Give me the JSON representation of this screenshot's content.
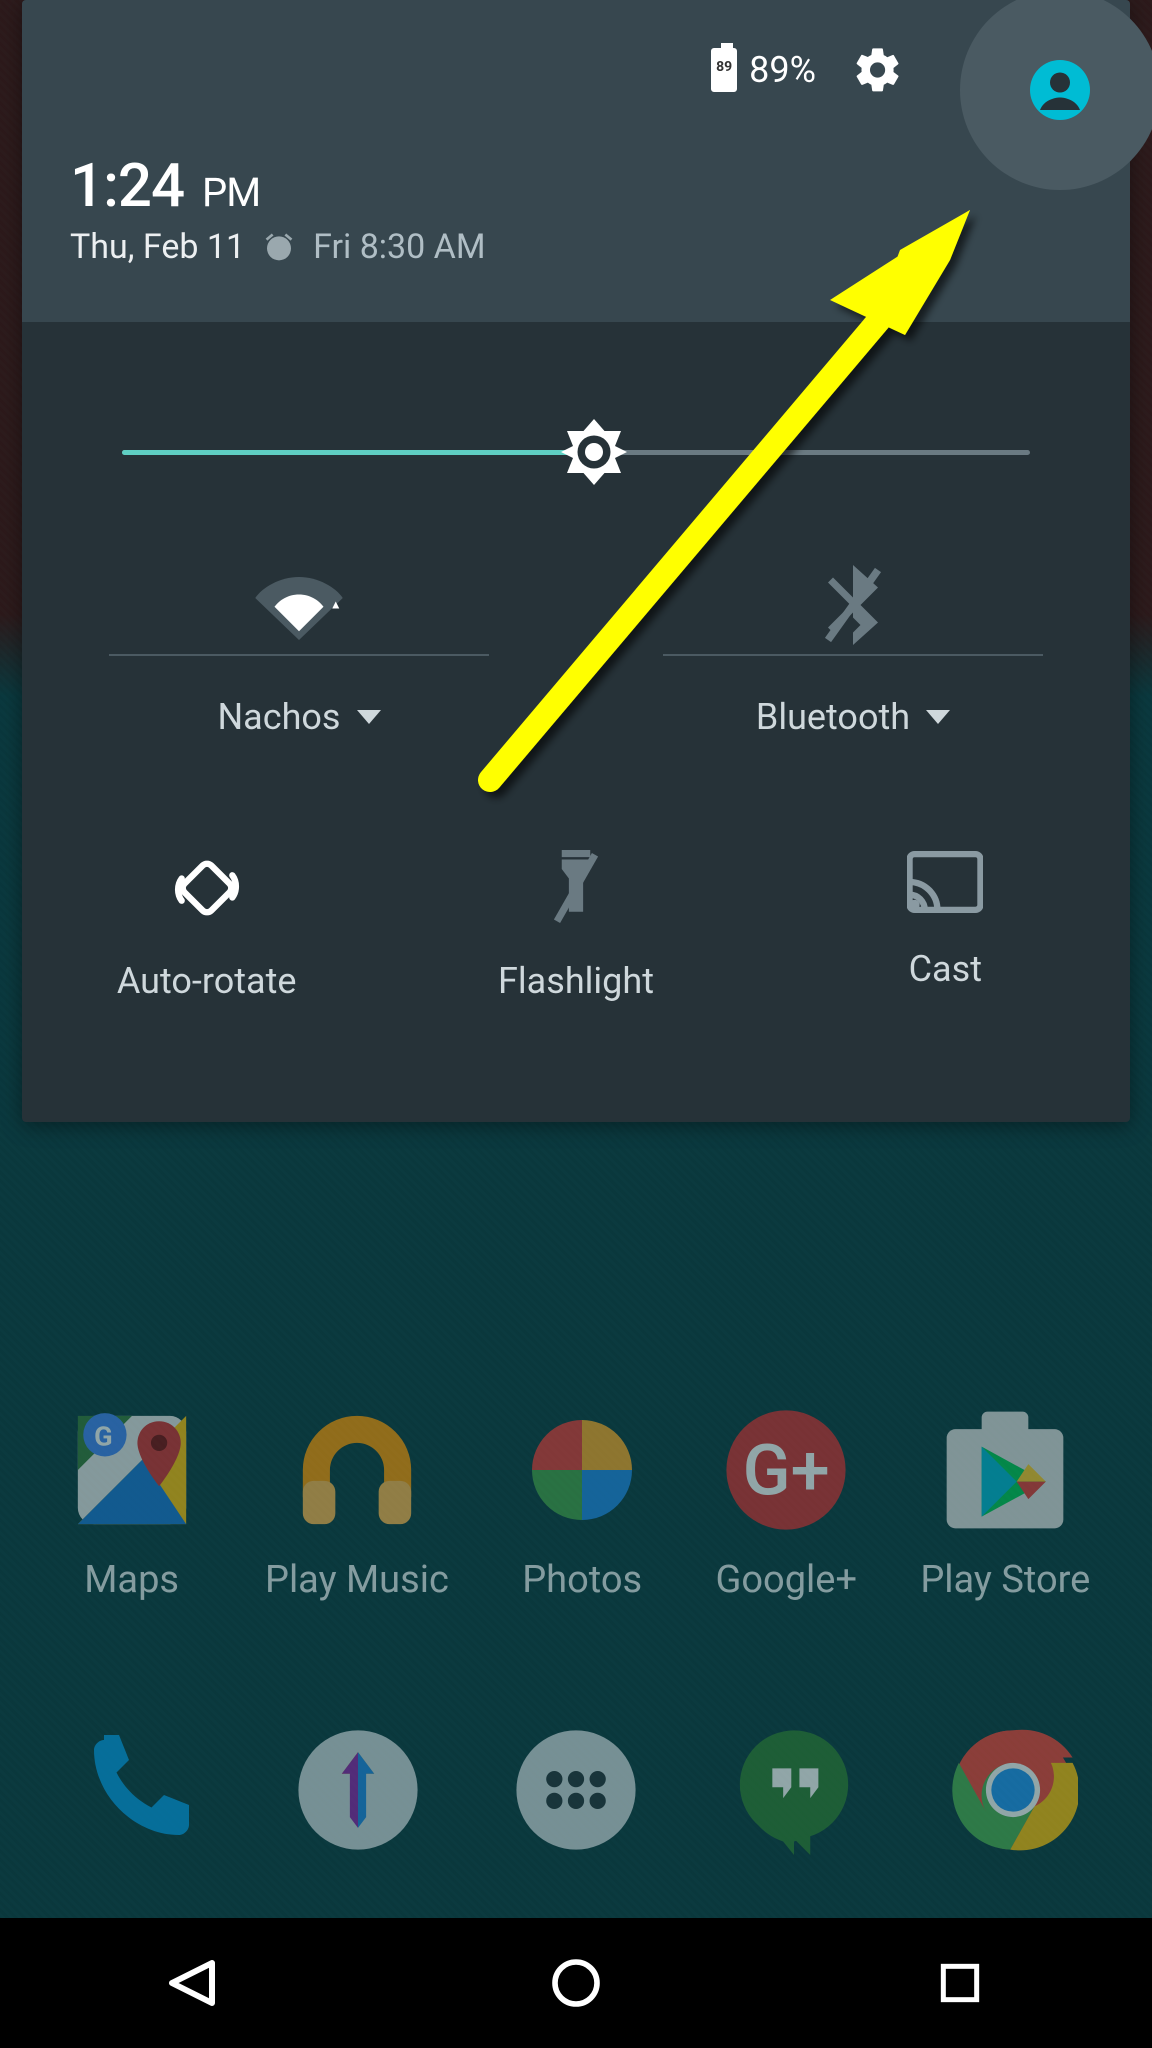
{
  "status": {
    "battery_pct": "89%",
    "battery_num": "89"
  },
  "clock": {
    "time": "1:24",
    "ampm": "PM",
    "date": "Thu, Feb 11",
    "alarm": "Fri 8:30 AM"
  },
  "brightness": {
    "value_pct": 52
  },
  "qs": {
    "wifi": {
      "label": "Nachos"
    },
    "bluetooth": {
      "label": "Bluetooth"
    },
    "rotate": {
      "label": "Auto-rotate"
    },
    "flashlight": {
      "label": "Flashlight"
    },
    "cast": {
      "label": "Cast"
    }
  },
  "apps": {
    "maps": "Maps",
    "music": "Play Music",
    "photos": "Photos",
    "gplus": "Google+",
    "store": "Play Store"
  },
  "colors": {
    "panel": "#263238",
    "header": "#37474f",
    "accent": "#00bcd4",
    "slider": "#5fcfc3",
    "annotation": "#ffff00"
  }
}
